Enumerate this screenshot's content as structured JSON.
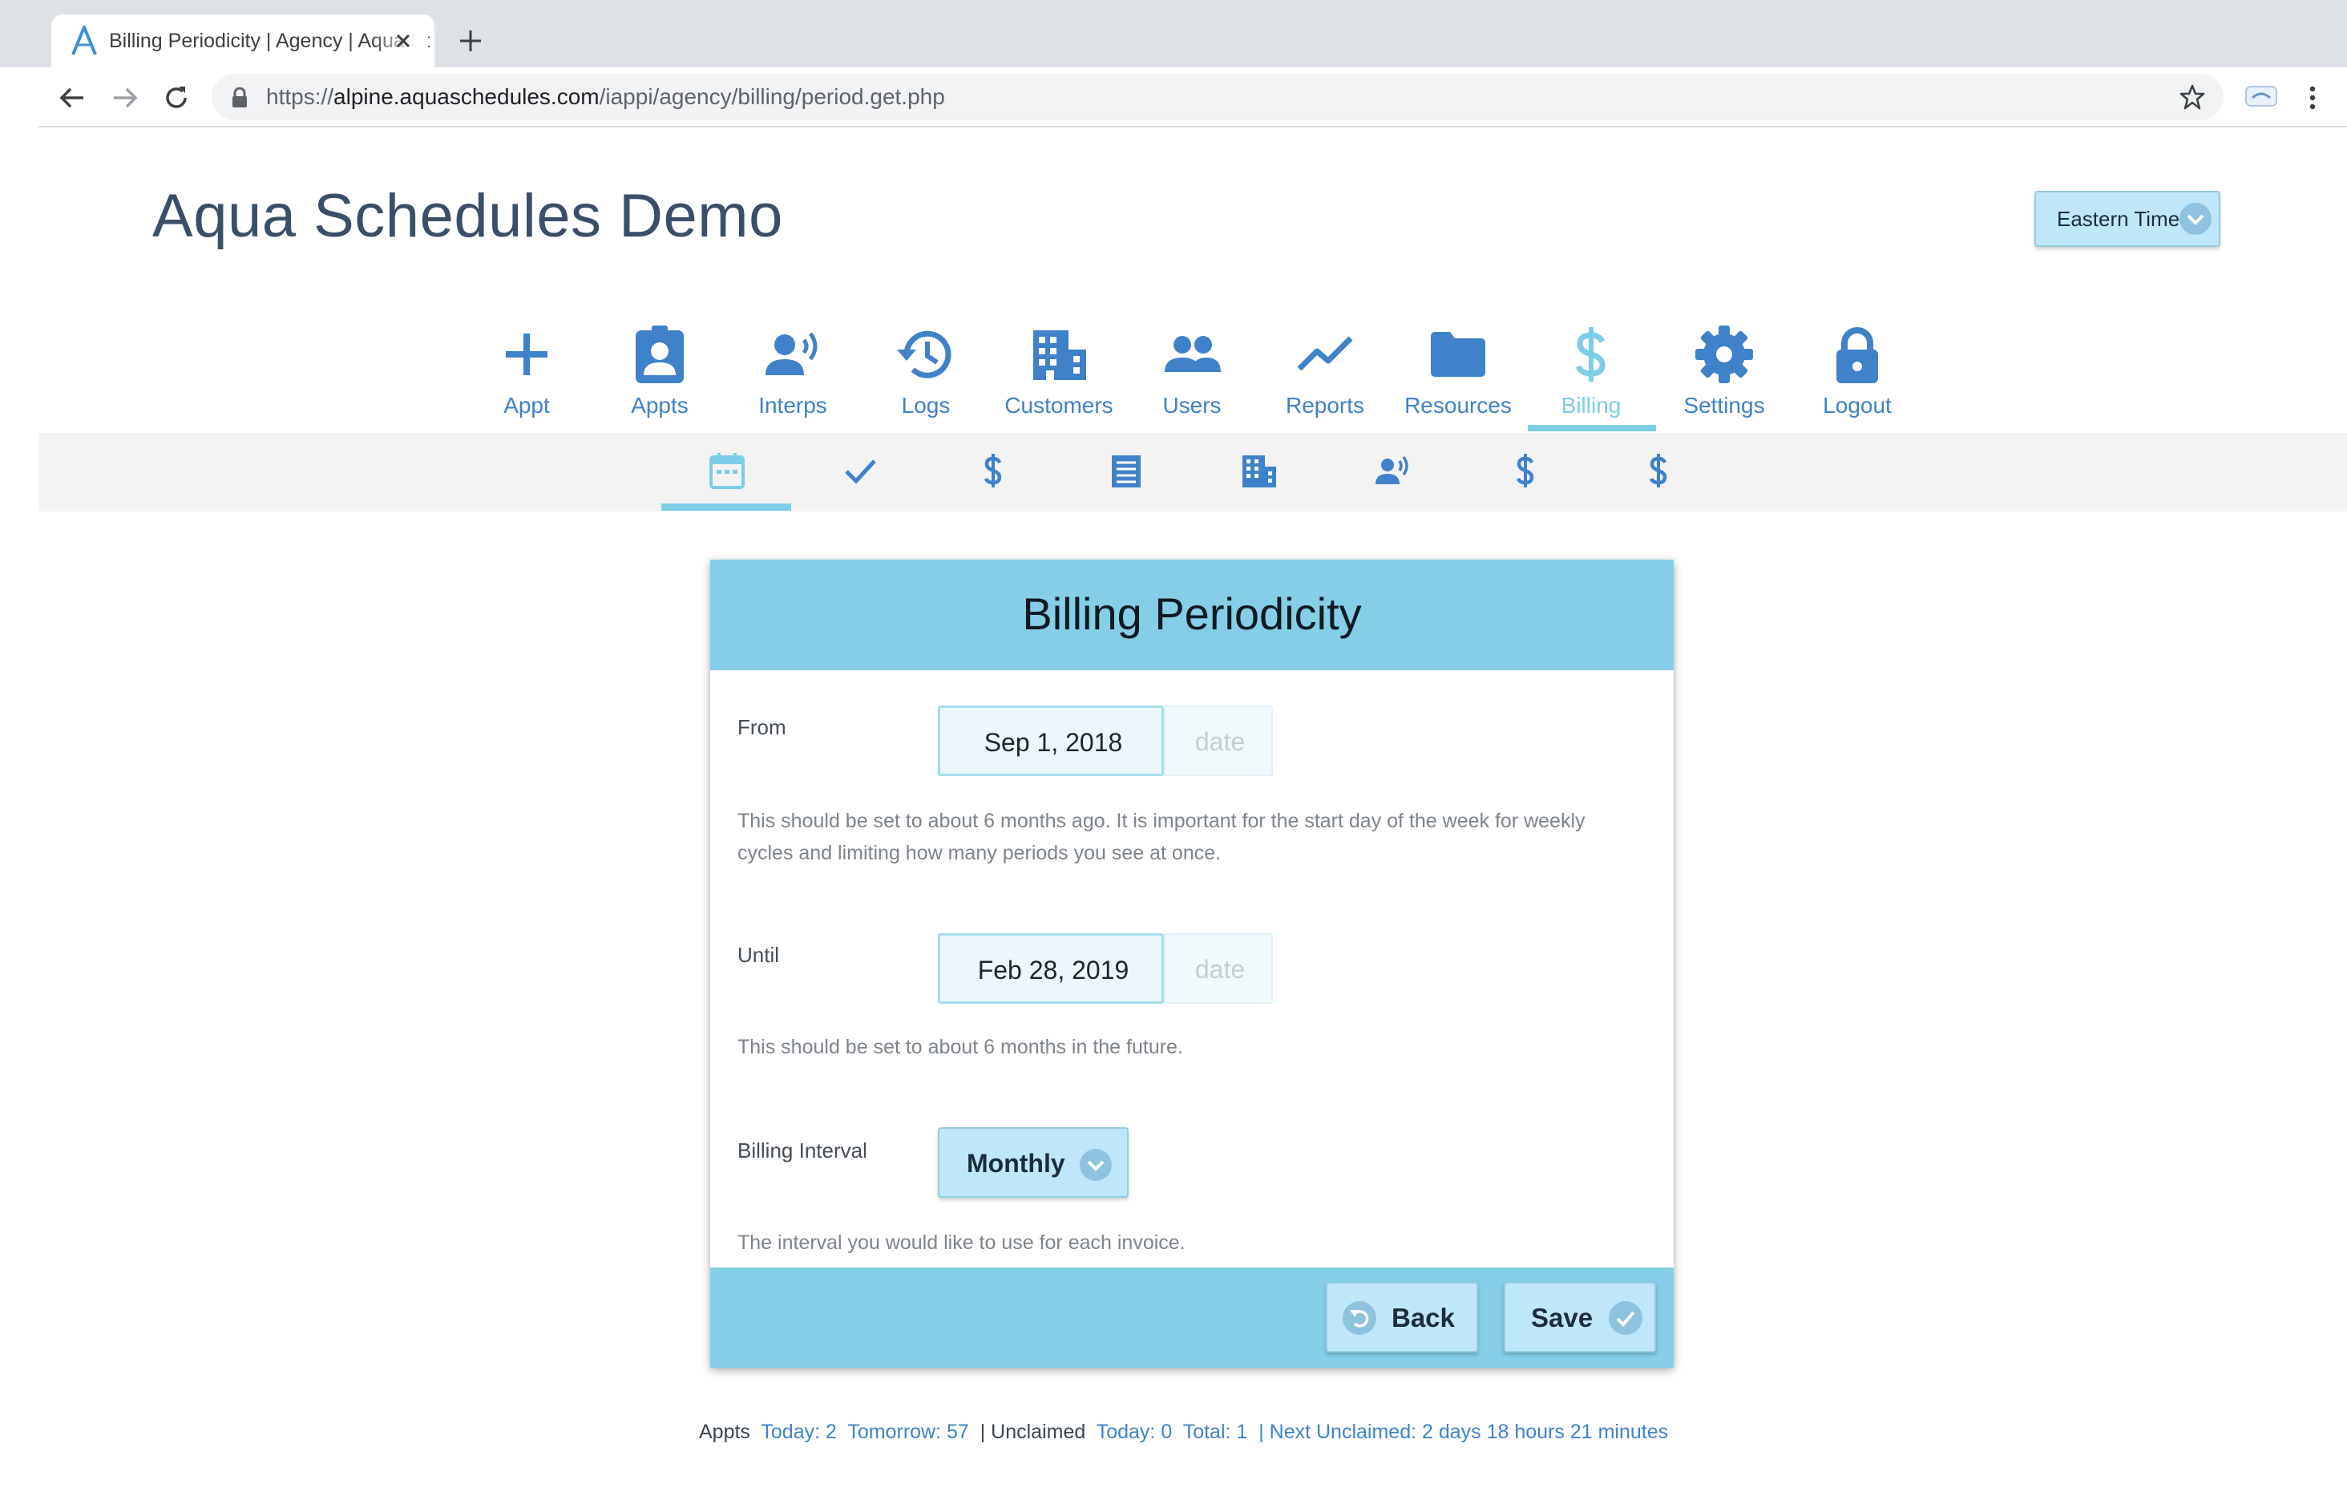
{
  "browser": {
    "tab_title": "Billing Periodicity | Agency | Aqua Schedules",
    "url_scheme": "https://",
    "url_host": "alpine.aquaschedules.com",
    "url_path": "/iappi/agency/billing/period.get.php"
  },
  "header": {
    "site_title": "Aqua Schedules Demo",
    "timezone": "Eastern Time"
  },
  "nav": {
    "items": [
      {
        "label": "Appt",
        "icon": "plus-icon"
      },
      {
        "label": "Appts",
        "icon": "contact-badge-icon"
      },
      {
        "label": "Interps",
        "icon": "interpreter-speaking-icon"
      },
      {
        "label": "Logs",
        "icon": "history-clock-icon"
      },
      {
        "label": "Customers",
        "icon": "building-icon"
      },
      {
        "label": "Users",
        "icon": "users-icon"
      },
      {
        "label": "Reports",
        "icon": "line-chart-icon"
      },
      {
        "label": "Resources",
        "icon": "folder-icon"
      },
      {
        "label": "Billing",
        "icon": "dollar-icon",
        "active": true
      },
      {
        "label": "Settings",
        "icon": "gear-icon"
      },
      {
        "label": "Logout",
        "icon": "lock-icon"
      }
    ]
  },
  "subnav": {
    "items": [
      {
        "icon": "calendar-icon",
        "active": true
      },
      {
        "icon": "checkmark-icon"
      },
      {
        "icon": "dollar-icon"
      },
      {
        "icon": "invoice-list-icon"
      },
      {
        "icon": "building-icon"
      },
      {
        "icon": "interpreter-speaking-icon"
      },
      {
        "icon": "dollar-icon"
      },
      {
        "icon": "dollar-icon"
      }
    ]
  },
  "card": {
    "title": "Billing Periodicity",
    "from": {
      "label": "From",
      "value": "Sep 1, 2018",
      "addon": "date",
      "help": "This should be set to about 6 months ago. It is important for the start day of the week for weekly cycles and limiting how many periods you see at once."
    },
    "until": {
      "label": "Until",
      "value": "Feb 28, 2019",
      "addon": "date",
      "help": "This should be set to about 6 months in the future."
    },
    "interval": {
      "label": "Billing Interval",
      "value": "Monthly",
      "help": "The interval you would like to use for each invoice."
    },
    "back_label": "Back",
    "save_label": "Save"
  },
  "status": {
    "appts_label": "Appts",
    "appts_today": "Today: 2",
    "appts_tomorrow": "Tomorrow: 57",
    "unclaimed_label": "| Unclaimed",
    "unclaimed_today": "Today: 0",
    "unclaimed_total": "Total: 1",
    "next_unclaimed": "| Next Unclaimed: 2 days 18 hours 21 minutes"
  },
  "colors": {
    "accent_blue": "#3f82c9",
    "active_cyan": "#7ccde6",
    "card_header": "#84cfe5",
    "button_bg": "#bfe7f7",
    "title_navy": "#3b4e68"
  }
}
